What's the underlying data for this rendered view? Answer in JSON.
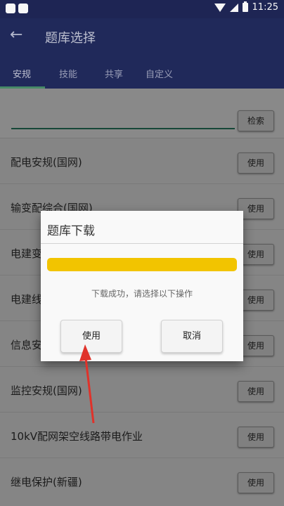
{
  "status_bar": {
    "time": "11:25",
    "icons": [
      "wifi-icon",
      "signal-icon",
      "battery-icon"
    ]
  },
  "app_bar": {
    "title": "题库选择",
    "back_icon": "arrow-left-icon"
  },
  "tabs": [
    {
      "label": "安规",
      "active": true
    },
    {
      "label": "技能",
      "active": false
    },
    {
      "label": "共享",
      "active": false
    },
    {
      "label": "自定义",
      "active": false
    }
  ],
  "search": {
    "button_label": "检索",
    "value": ""
  },
  "list": [
    {
      "label": "配电安规(国网)",
      "button": "使用"
    },
    {
      "label": "输变配综合(国网)",
      "button": "使用"
    },
    {
      "label": "电建变",
      "button": "使用"
    },
    {
      "label": "电建线",
      "button": "使用"
    },
    {
      "label": "信息安",
      "button": "使用"
    },
    {
      "label": "监控安规(国网)",
      "button": "使用"
    },
    {
      "label": "10kV配网架空线路带电作业",
      "button": "使用"
    },
    {
      "label": "继电保护(新疆)",
      "button": "使用"
    }
  ],
  "dialog": {
    "title": "题库下载",
    "progress": 1.0,
    "message": "下载成功，请选择以下操作",
    "use_button": "使用",
    "cancel_button": "取消"
  },
  "colors": {
    "header": "#222b5d",
    "progress": "#f2c400",
    "annotation_arrow": "#e0322a"
  }
}
